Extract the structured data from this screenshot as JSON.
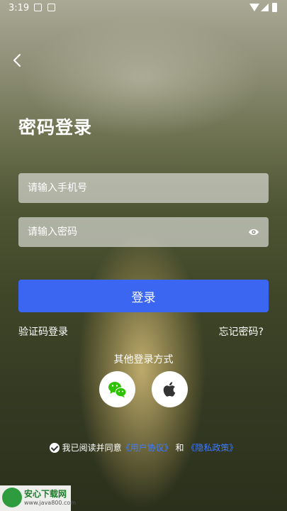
{
  "status_bar": {
    "time": "3:19"
  },
  "page": {
    "title": "密码登录"
  },
  "form": {
    "phone_placeholder": "请输入手机号",
    "password_placeholder": "请输入密码"
  },
  "buttons": {
    "login": "登录",
    "sms_login": "验证码登录",
    "forgot_password": "忘记密码?"
  },
  "other_login": {
    "label": "其他登录方式"
  },
  "agreement": {
    "prefix": "我已阅读并同意",
    "user_agreement": "《用户协议》",
    "and": "和",
    "privacy_policy": "《隐私政策》"
  },
  "watermark": {
    "name": "安心下载网",
    "url": "www.java800.com"
  },
  "colors": {
    "primary": "#3a66f1",
    "link": "#3e7cff"
  }
}
